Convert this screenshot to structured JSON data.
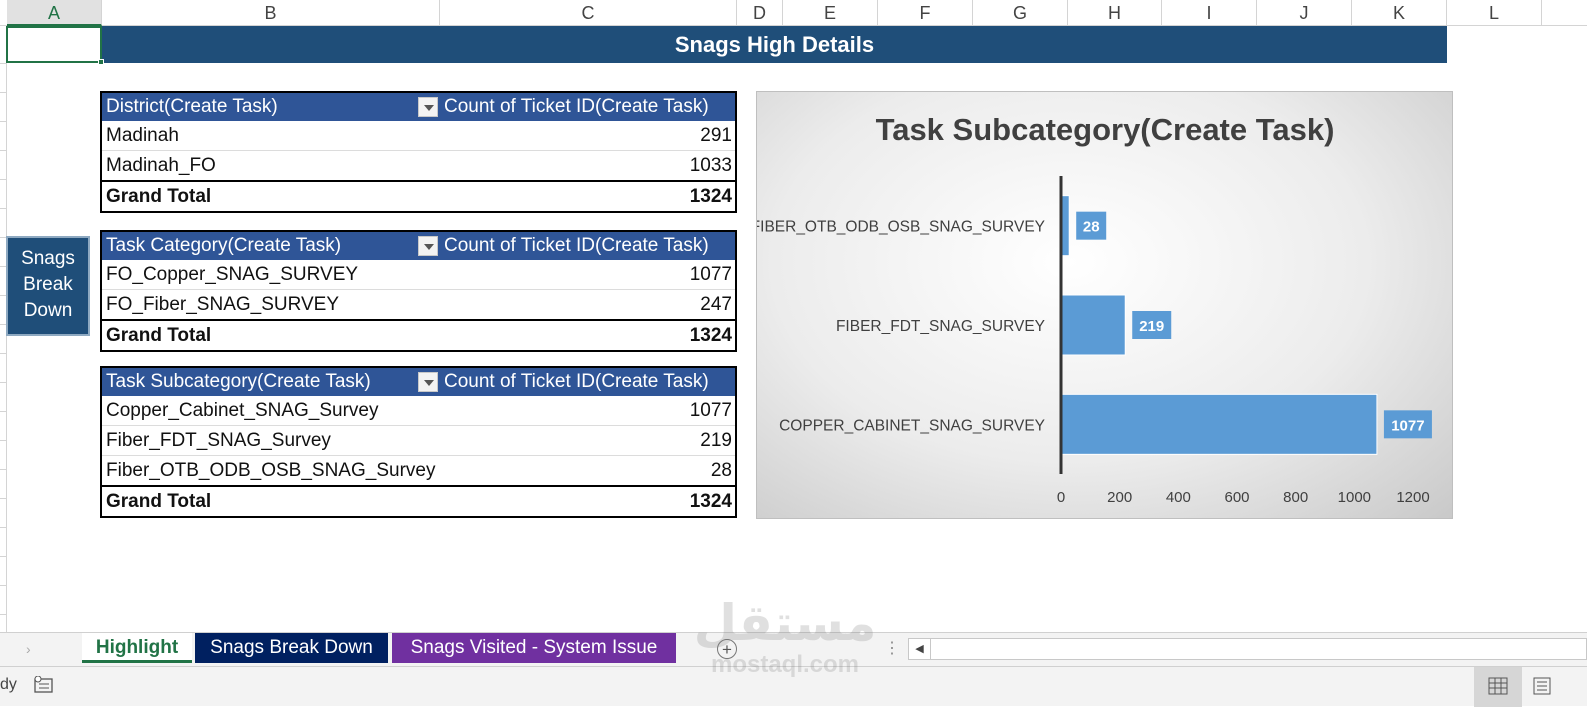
{
  "columns": [
    "A",
    "B",
    "C",
    "D",
    "E",
    "F",
    "G",
    "H",
    "I",
    "J",
    "K",
    "L"
  ],
  "selected_column": "A",
  "title": "Snags High Details",
  "pivot_tables": [
    {
      "header": [
        "District(Create Task)",
        "Count of Ticket ID(Create Task)"
      ],
      "rows": [
        {
          "label": "Madinah",
          "value": "291"
        },
        {
          "label": "Madinah_FO",
          "value": "1033"
        }
      ],
      "total": {
        "label": "Grand Total",
        "value": "1324"
      }
    },
    {
      "header": [
        "Task Category(Create Task)",
        "Count of Ticket ID(Create Task)"
      ],
      "rows": [
        {
          "label": "FO_Copper_SNAG_SURVEY",
          "value": "1077"
        },
        {
          "label": "FO_Fiber_SNAG_SURVEY",
          "value": "247"
        }
      ],
      "total": {
        "label": "Grand Total",
        "value": "1324"
      }
    },
    {
      "header": [
        "Task Subcategory(Create Task)",
        "Count of Ticket ID(Create Task)"
      ],
      "rows": [
        {
          "label": "Copper_Cabinet_SNAG_Survey",
          "value": "1077"
        },
        {
          "label": "Fiber_FDT_SNAG_Survey",
          "value": "219"
        },
        {
          "label": "Fiber_OTB_ODB_OSB_SNAG_Survey",
          "value": "28"
        }
      ],
      "total": {
        "label": "Grand Total",
        "value": "1324"
      }
    }
  ],
  "side_button": {
    "lines": [
      "Snags",
      "Break",
      "Down"
    ]
  },
  "chart_data": {
    "type": "bar",
    "orientation": "horizontal",
    "title": "Task Subcategory(Create Task)",
    "categories": [
      "FIBER_OTB_ODB_OSB_SNAG_SURVEY",
      "FIBER_FDT_SNAG_SURVEY",
      "COPPER_CABINET_SNAG_SURVEY"
    ],
    "values": [
      28,
      219,
      1077
    ],
    "xlim": [
      0,
      1200
    ],
    "xticks": [
      0,
      200,
      400,
      600,
      800,
      1000,
      1200
    ],
    "grid": false,
    "bar_color": "#5b9bd5",
    "label_color": "#5b9bd5"
  },
  "sheet_tabs": [
    {
      "label": "Highlight",
      "active": true
    },
    {
      "label": "Snags Break Down",
      "active": false,
      "color": "#002060"
    },
    {
      "label": "Snags Visited - System Issue",
      "active": false,
      "color": "#7030a0"
    }
  ],
  "status": {
    "text": "dy"
  },
  "watermark": {
    "arabic": "مستقل",
    "latin": "mostaql.com"
  }
}
